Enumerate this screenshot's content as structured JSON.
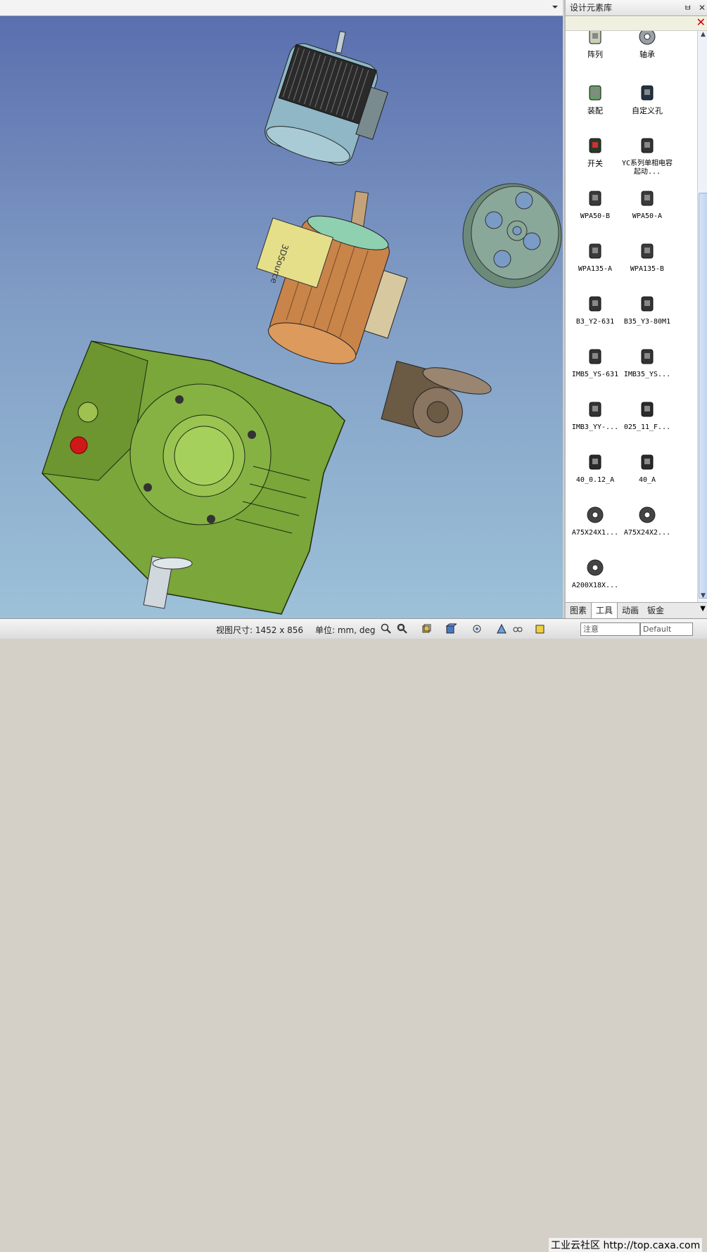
{
  "viewport": {
    "dropdown_icon": "chevron-down-icon"
  },
  "panel": {
    "title": "设计元素库",
    "pin_label": "ㅂ",
    "close_label": "✕",
    "clear_label": "✕",
    "items": [
      {
        "label": "阵列",
        "icon": "array-icon"
      },
      {
        "label": "轴承",
        "icon": "bearing-icon"
      },
      {
        "label": "装配",
        "icon": "assembly-icon"
      },
      {
        "label": "自定义孔",
        "icon": "custom-hole-icon"
      },
      {
        "label": "开关",
        "icon": "switch-icon"
      },
      {
        "label": "YC系列单相电容起动...",
        "icon": "motor-icon"
      },
      {
        "label": "WPA50-B",
        "icon": "reducer-icon"
      },
      {
        "label": "WPA50-A",
        "icon": "reducer-icon"
      },
      {
        "label": "WPA135-A",
        "icon": "reducer-icon"
      },
      {
        "label": "WPA135-B",
        "icon": "reducer-icon"
      },
      {
        "label": "B3_Y2-631",
        "icon": "motor-icon"
      },
      {
        "label": "B35_Y3-80M1",
        "icon": "motor-icon"
      },
      {
        "label": "IMB5_YS-631",
        "icon": "motor-icon"
      },
      {
        "label": "IMB35_YS...",
        "icon": "motor-icon"
      },
      {
        "label": "IMB3_YY-...",
        "icon": "motor-icon"
      },
      {
        "label": "025_11_F...",
        "icon": "gearbox-icon"
      },
      {
        "label": "40_0.12_A",
        "icon": "gearbox-icon"
      },
      {
        "label": "40_A",
        "icon": "gearbox-icon"
      },
      {
        "label": "A75X24X1...",
        "icon": "pulley-icon"
      },
      {
        "label": "A75X24X2...",
        "icon": "pulley-icon"
      },
      {
        "label": "A200X18X...",
        "icon": "pulley-icon"
      }
    ],
    "tabs": [
      "图素",
      "工具",
      "动画",
      "钣金"
    ],
    "active_tab": "工具"
  },
  "status": {
    "view_size": "视图尺寸: 1452 x  856",
    "units": "单位: mm, deg",
    "watermark": "工业云社区 http://top.caxa.com",
    "input1": "注意",
    "input2": "Default"
  },
  "colors": {
    "viewport_top": "#5a6fae",
    "viewport_bottom": "#9cc1d8",
    "reducer_green": "#7aa63a",
    "motor_copper": "#c9844a",
    "motor_blue": "#8fb7c6"
  }
}
